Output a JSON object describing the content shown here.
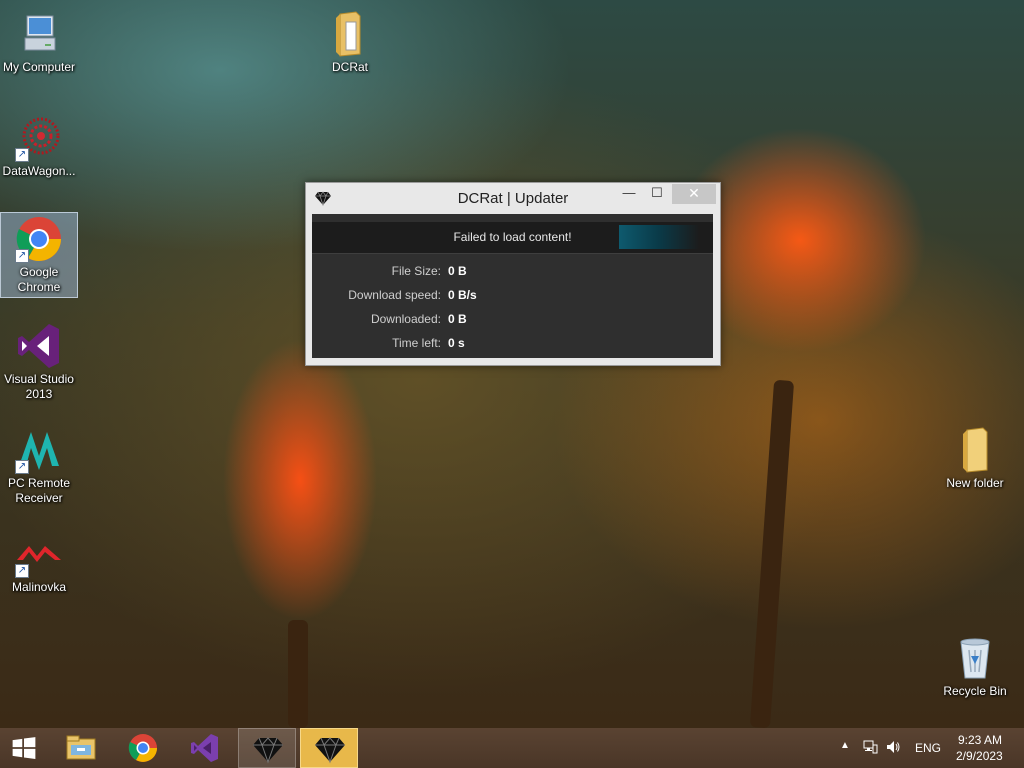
{
  "desktop": {
    "icons_left": [
      {
        "label": "My Computer",
        "icon": "computer-icon",
        "shortcut": false
      },
      {
        "label": "DataWagon...",
        "icon": "datawagon-icon",
        "shortcut": true
      },
      {
        "label": "Google Chrome",
        "icon": "chrome-icon",
        "shortcut": true,
        "selected": true
      },
      {
        "label": "Visual Studio 2013",
        "icon": "visual-studio-icon",
        "shortcut": false
      },
      {
        "label": "PC Remote Receiver",
        "icon": "pc-remote-icon",
        "shortcut": true
      },
      {
        "label": "Malinovka",
        "icon": "malinovka-icon",
        "shortcut": true
      }
    ],
    "icon_dcrat": {
      "label": "DCRat",
      "icon": "folder-icon"
    },
    "icon_new_folder": {
      "label": "New folder",
      "icon": "folder-icon"
    },
    "icon_recycle_bin": {
      "label": "Recycle Bin",
      "icon": "recycle-bin-icon"
    }
  },
  "window": {
    "title": "DCRat | Updater",
    "app_icon": "diamond-icon",
    "controls": {
      "minimize": "—",
      "maximize": "☐",
      "close": "✕"
    },
    "status_message": "Failed to load content!",
    "fields": [
      {
        "label": "File Size:",
        "value": "0 B"
      },
      {
        "label": "Download speed:",
        "value": "0 B/s"
      },
      {
        "label": "Downloaded:",
        "value": "0 B"
      },
      {
        "label": "Time left:",
        "value": "0 s"
      }
    ]
  },
  "taskbar": {
    "start_icon": "windows-start-icon",
    "pinned": [
      "file-explorer-icon",
      "chrome-icon",
      "visual-studio-icon",
      "diamond-icon",
      "diamond-icon"
    ],
    "tray": {
      "language": "ENG",
      "time": "9:23 AM",
      "date": "2/9/2023",
      "icons": [
        "chevron-up-icon",
        "network-icon",
        "volume-icon"
      ]
    }
  },
  "colors": {
    "taskbar": "#4a3627",
    "window_client": "#2f2f2f",
    "active_taskbar_button": "#e8b84a",
    "progress_accent": "#0e5a6e"
  }
}
